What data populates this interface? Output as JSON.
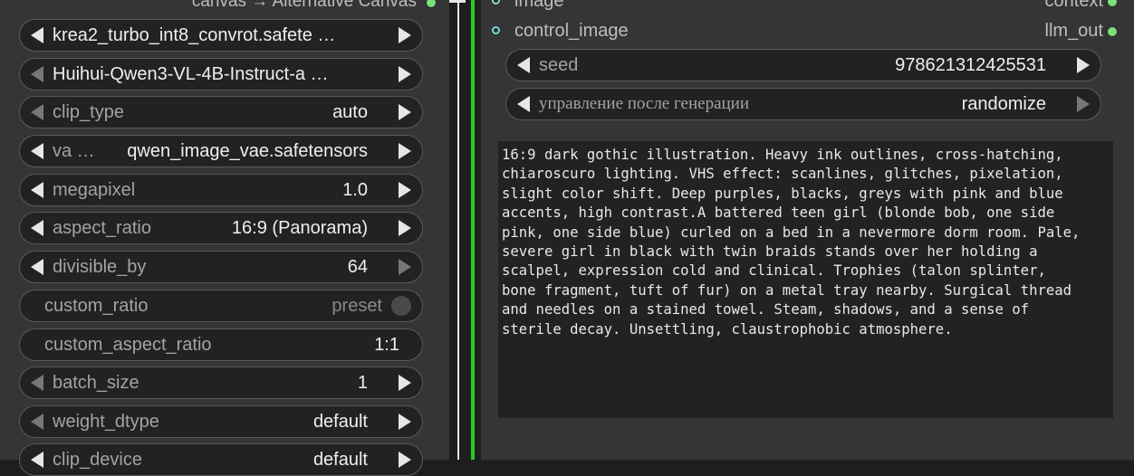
{
  "left_node": {
    "top_output_label": "canvas → Alternative Canvas",
    "widgets": [
      {
        "label": "",
        "value": "krea2_turbo_int8_convrot.safete …"
      },
      {
        "label": "",
        "value": "Huihui-Qwen3-VL-4B-Instruct-a …"
      },
      {
        "label": "clip_type",
        "value": "auto"
      },
      {
        "label": "va …",
        "value": "qwen_image_vae.safetensors"
      },
      {
        "label": "megapixel",
        "value": "1.0"
      },
      {
        "label": "aspect_ratio",
        "value": "16:9 (Panorama)"
      },
      {
        "label": "divisible_by",
        "value": "64"
      },
      {
        "label": "custom_ratio",
        "value": "preset"
      },
      {
        "label": "custom_aspect_ratio",
        "value": "1:1"
      },
      {
        "label": "batch_size",
        "value": "1"
      },
      {
        "label": "weight_dtype",
        "value": "default"
      },
      {
        "label": "clip_device",
        "value": "default"
      }
    ]
  },
  "right_node": {
    "inputs": [
      {
        "label": "image"
      },
      {
        "label": "control_image"
      }
    ],
    "outputs": [
      {
        "label": "context"
      },
      {
        "label": "llm_out"
      }
    ],
    "seed": {
      "label": "seed",
      "value": "978621312425531"
    },
    "control_after_generate": {
      "label": "управление после генерации",
      "value": "randomize"
    },
    "prompt": "16:9 dark gothic illustration. Heavy ink outlines, cross-hatching,\nchiaroscuro lighting. VHS effect: scanlines, glitches, pixelation,\nslight color shift. Deep purples, blacks, greys with pink and blue\naccents, high contrast.A battered teen girl (blonde bob, one side\npink, one side blue) curled on a bed in a nevermore dorm room. Pale,\nsevere girl in black with twin braids stands over her holding a\nscalpel, expression cold and clinical. Trophies (talon splinter,\nbone fragment, tuft of fur) on a metal tray nearby. Surgical thread\nand needles on a stained towel. Steam, shadows, and a sense of\nsterile decay. Unsettling, claustrophobic atmosphere."
  },
  "colors": {
    "node_bg": "#353535",
    "widget_bg": "#222222",
    "link_green": "#1fd11f",
    "output_dot": "#7be07b"
  }
}
